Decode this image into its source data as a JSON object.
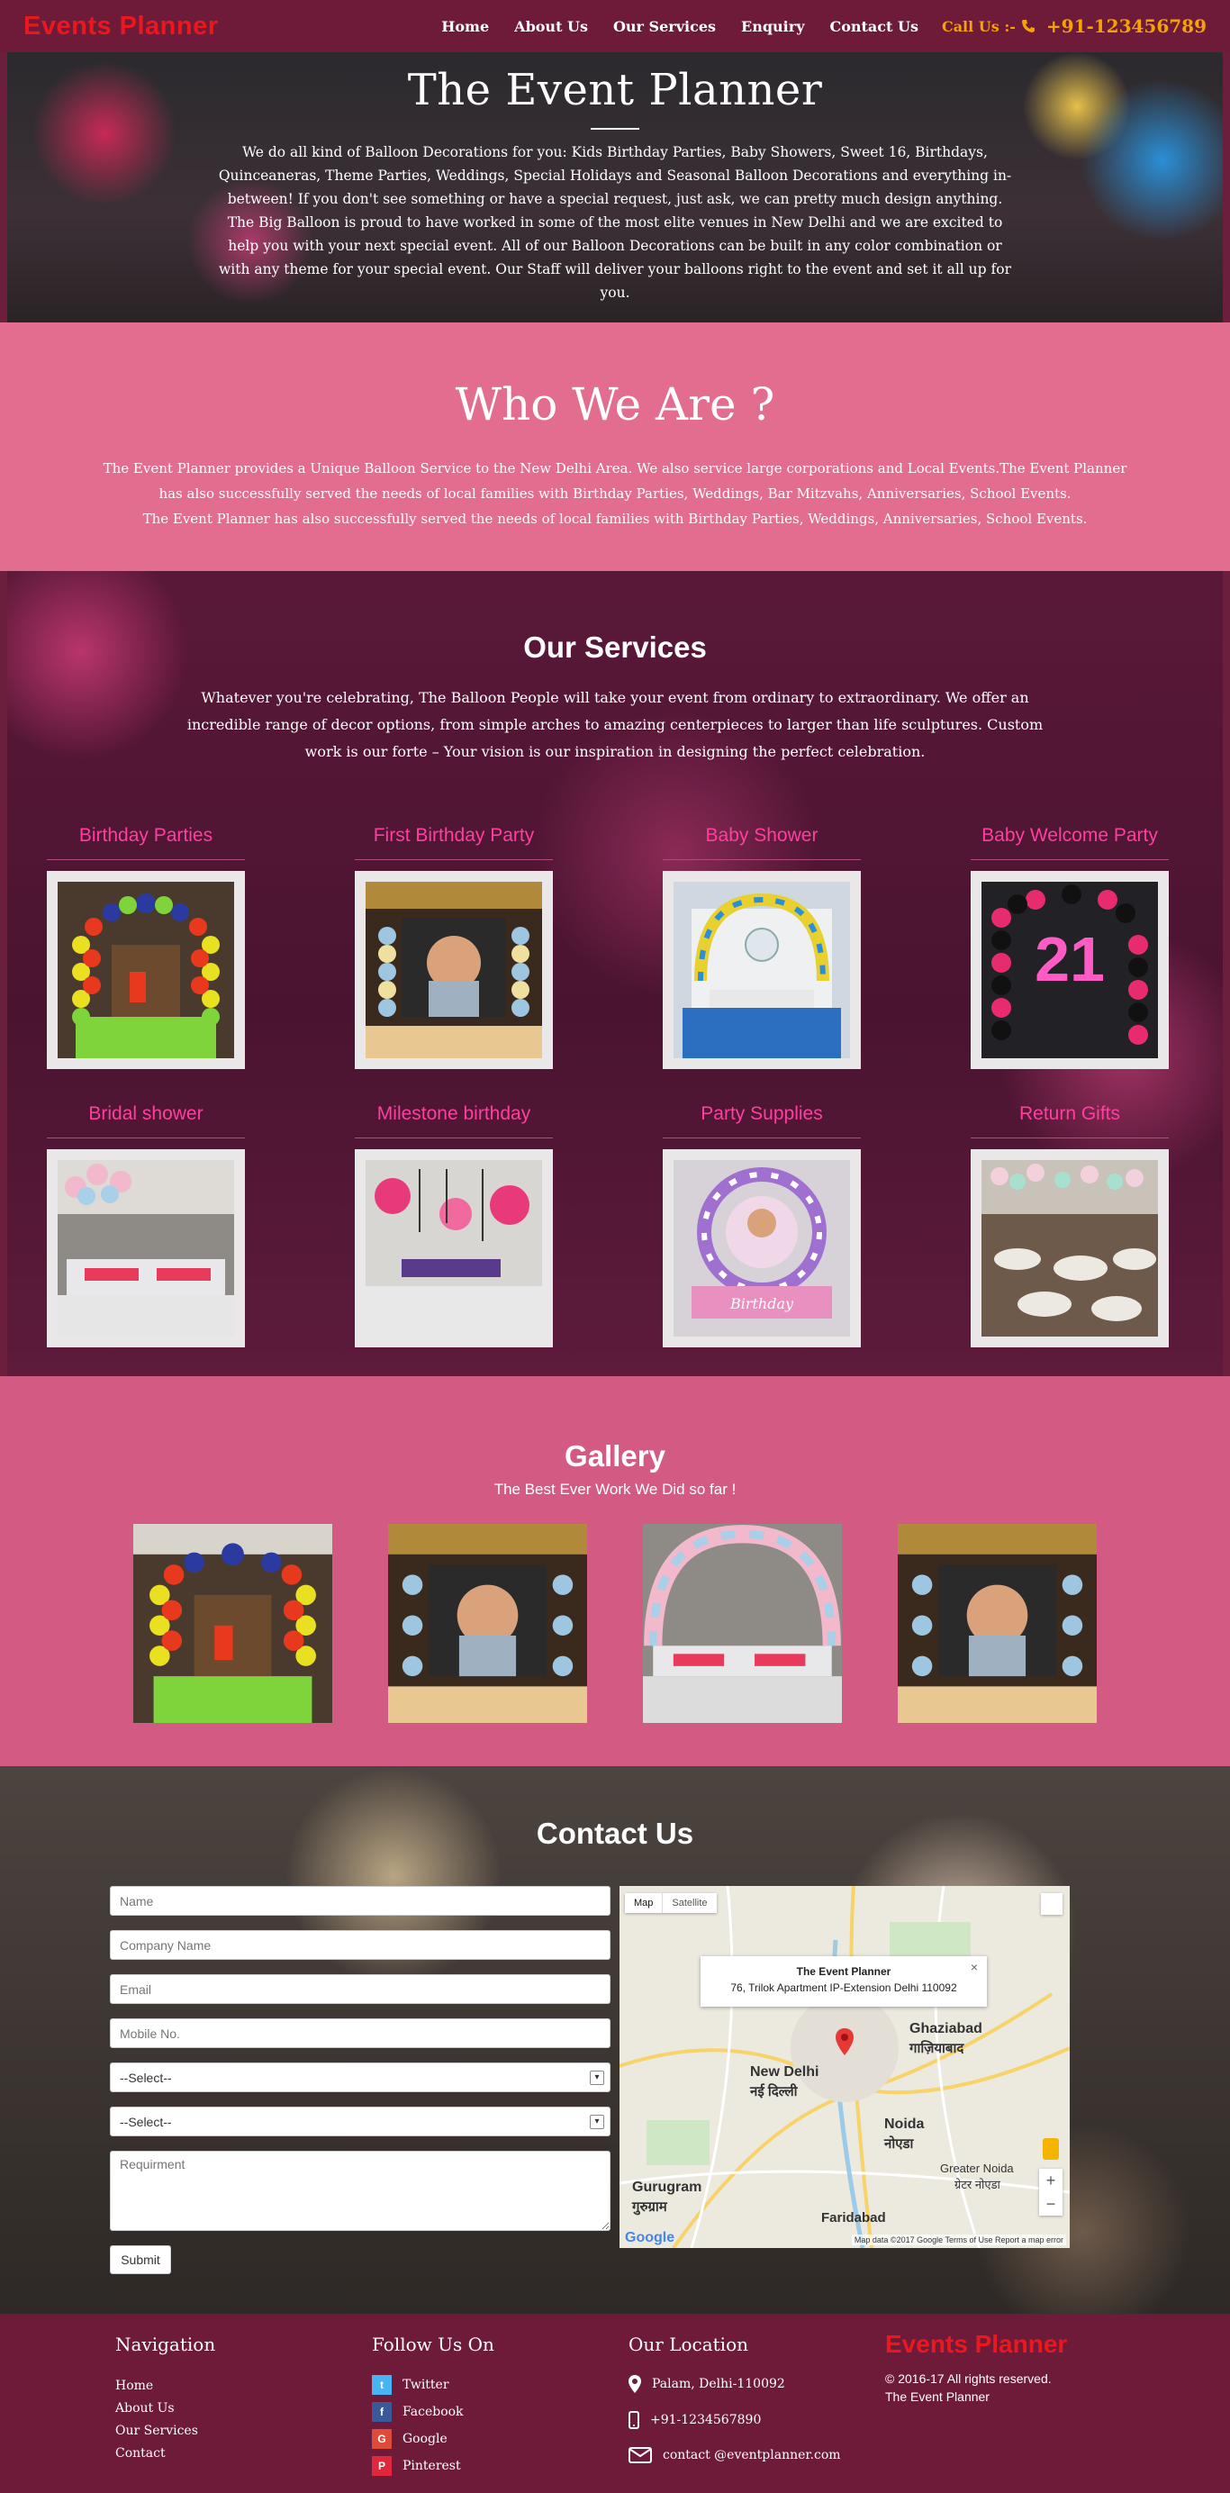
{
  "header": {
    "logo": "Events Planner",
    "nav": [
      "Home",
      "About Us",
      "Our Services",
      "Enquiry",
      "Contact Us"
    ],
    "call_label": "Call Us :-",
    "phone": "+91-123456789",
    "accent_color": "#f4a300"
  },
  "hero": {
    "title": "The Event Planner",
    "text": "We do all kind of Balloon Decorations for you: Kids Birthday Parties, Baby Showers, Sweet 16, Birthdays, Quinceaneras, Theme Parties, Weddings, Special Holidays and Seasonal Balloon Decorations and everything in-between! If you don't see something or have a special request, just ask, we can pretty much design anything.",
    "text2": "The Big Balloon is proud to have worked in some of the most elite venues in New Delhi and we are excited to help you with your next special event. All of our Balloon Decorations can be built in any color combination or with any theme for your special event. Our Staff will deliver your balloons right to the event and set it all up for you."
  },
  "who": {
    "title": "Who We Are ?",
    "text": "The Event Planner provides a Unique Balloon Service to the New Delhi Area. We also service large corporations and Local Events.The Event Planner has also successfully served the needs of local families with Birthday Parties, Weddings, Bar Mitzvahs, Anniversaries, School Events.",
    "text2": "The Event Planner has also successfully served the needs of local families with Birthday Parties, Weddings, Anniversaries, School Events."
  },
  "services": {
    "title": "Our Services",
    "text": "Whatever you're celebrating, The Balloon People will take your event from ordinary to extraordinary. We offer an incredible range of decor options, from simple arches to amazing centerpieces to larger than life sculptures. Custom work is our forte – Your vision is our inspiration in designing the perfect celebration.",
    "items": [
      {
        "title": "Birthday Parties"
      },
      {
        "title": "First Birthday Party"
      },
      {
        "title": "Baby Shower"
      },
      {
        "title": "Baby Welcome Party"
      },
      {
        "title": "Bridal shower"
      },
      {
        "title": "Milestone birthday"
      },
      {
        "title": "Party Supplies"
      },
      {
        "title": "Return Gifts"
      }
    ]
  },
  "gallery": {
    "title": "Gallery",
    "subtitle": "The Best Ever Work We Did so far !"
  },
  "contact": {
    "title": "Contact Us",
    "name_ph": "Name",
    "company_ph": "Company Name",
    "email_ph": "Email",
    "mobile_ph": "Mobile No.",
    "select1": "--Select--",
    "select2": "--Select--",
    "requirement_ph": "Requirment",
    "submit": "Submit",
    "map": {
      "tab_map": "Map",
      "tab_sat": "Satellite",
      "popup_title": "The Event Planner",
      "popup_addr": "76, Trilok Apartment IP-Extension Delhi 110092",
      "city1": "New Delhi",
      "city1_hi": "नई दिल्ली",
      "city2": "Ghaziabad",
      "city2_hi": "गाज़ियाबाद",
      "city3": "Noida",
      "city3_hi": "नोएडा",
      "city4": "Gurugram",
      "city4_hi": "गुरुग्राम",
      "city5": "Faridabad",
      "city6": "Greater Noida",
      "city6_hi": "ग्रेटर नोएडा",
      "google": "Google",
      "footer": "Map data ©2017 Google   Terms of Use   Report a map error"
    }
  },
  "footer": {
    "nav_title": "Navigation",
    "nav_links": [
      "Home",
      "About Us",
      "Our Services",
      "Contact"
    ],
    "follow_title": "Follow Us On",
    "social": [
      "Twitter",
      "Facebook",
      "Google",
      "Pinterest"
    ],
    "location_title": "Our Location",
    "address": "Palam, Delhi-110092",
    "phone": "+91-1234567890",
    "email": "contact @eventplanner.com",
    "logo": "Events Planner",
    "copyright": "© 2016-17 All rights reserved.",
    "company": "The Event Planner"
  }
}
